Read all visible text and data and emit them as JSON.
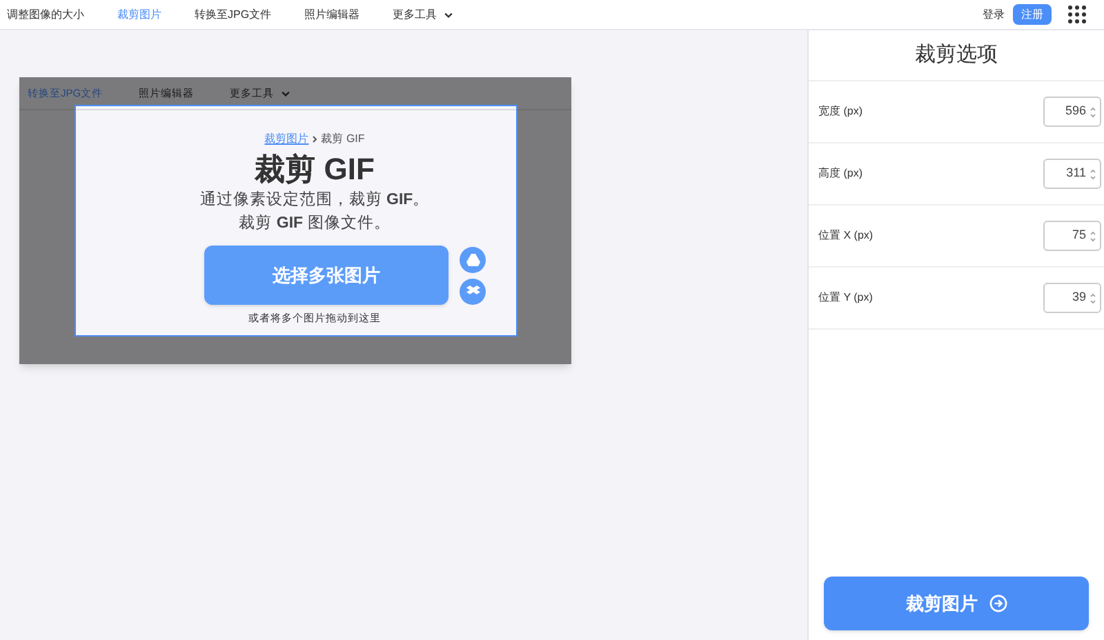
{
  "nav": {
    "items": [
      {
        "label": "调整图像的大小",
        "selected": false
      },
      {
        "label": "裁剪图片",
        "selected": true
      },
      {
        "label": "转换至JPG文件",
        "selected": false
      },
      {
        "label": "照片编辑器",
        "selected": false
      }
    ],
    "more": "更多工具",
    "login": "登录",
    "signup": "注册"
  },
  "preview": {
    "nav": [
      {
        "label": "转换至JPG文件",
        "selected": true
      },
      {
        "label": "照片编辑器",
        "selected": false
      }
    ],
    "more": "更多工具",
    "breadcrumb_link": "裁剪图片",
    "breadcrumb_current": "裁剪 GIF",
    "title": "裁剪 GIF",
    "subtitle": [
      "通过像素设定范围，裁剪 **GIF**。",
      "裁剪 **GIF** 图像文件。"
    ],
    "button": "选择多张图片",
    "hint": "或者将多个图片拖动到这里"
  },
  "panel": {
    "title": "裁剪选项",
    "fields": [
      {
        "label": "宽度 (px)",
        "value": "596"
      },
      {
        "label": "高度 (px)",
        "value": "311"
      },
      {
        "label": "位置 X (px)",
        "value": "75"
      },
      {
        "label": "位置 Y (px)",
        "value": "39"
      }
    ],
    "action": "裁剪图片"
  }
}
